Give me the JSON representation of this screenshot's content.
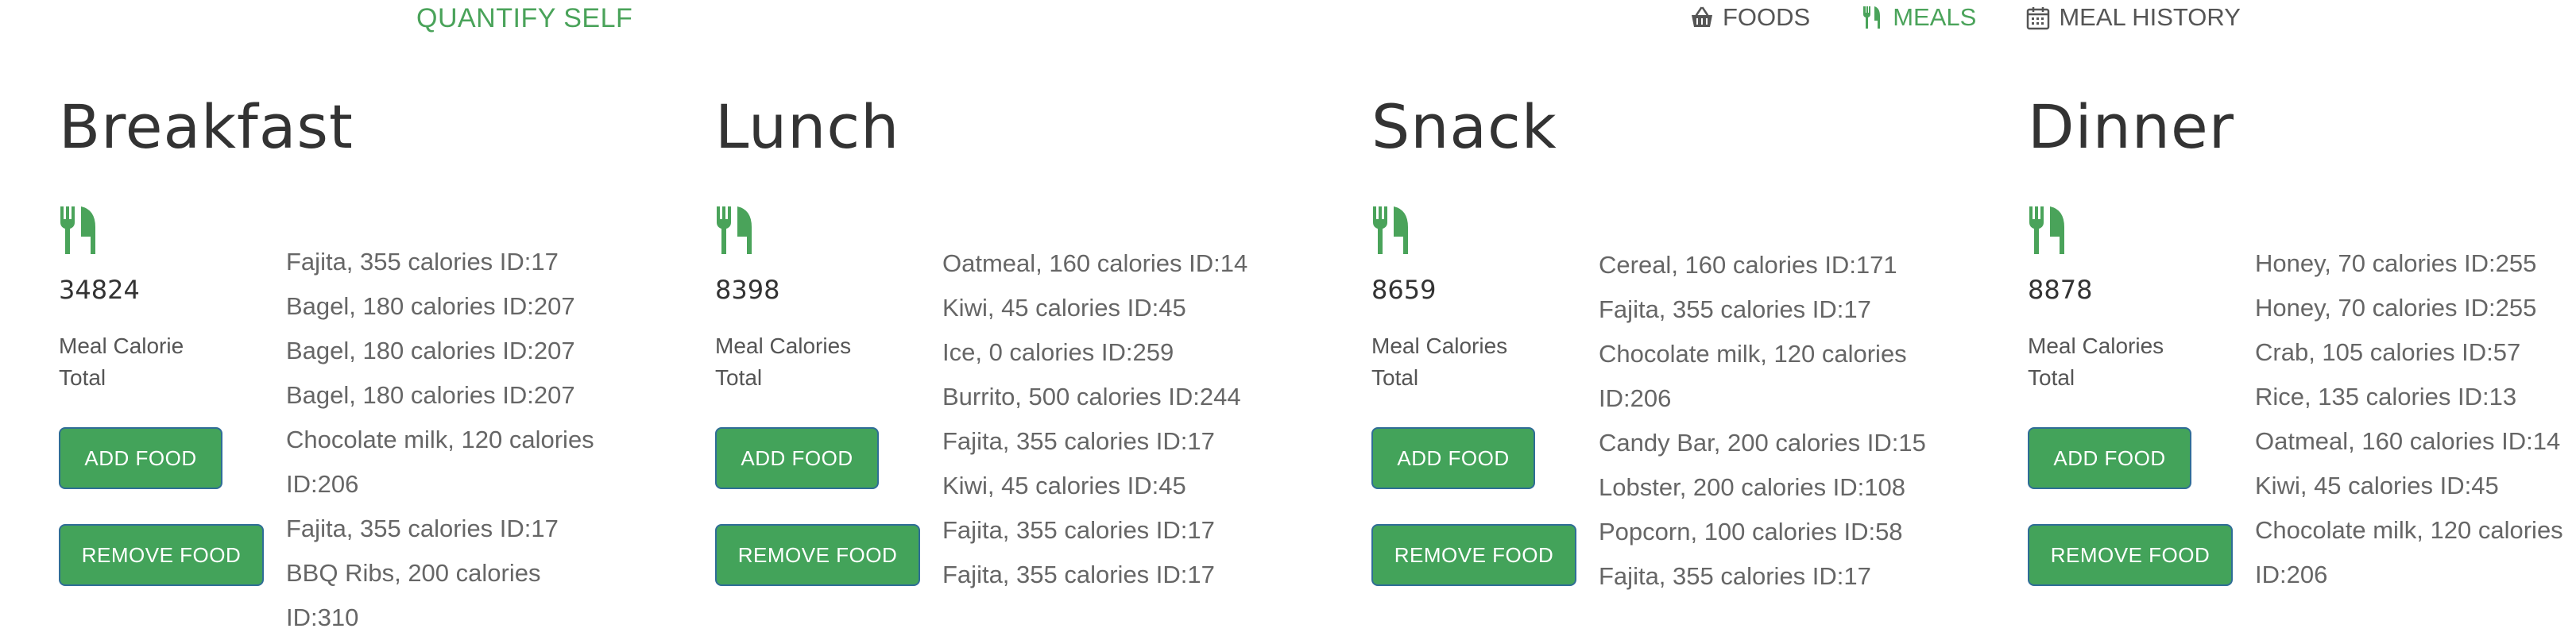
{
  "brand": "QUANTIFY SELF",
  "nav": {
    "foods": "FOODS",
    "meals": "MEALS",
    "history": "MEAL HISTORY"
  },
  "accent_color": "#4aa35a",
  "meals": [
    {
      "title": "Breakfast",
      "total": "34824",
      "total_label": "Meal Calorie Total",
      "add_label": "ADD FOOD",
      "remove_label": "REMOVE FOOD",
      "foods": [
        "Fajita, 355 calories ID:17",
        "Bagel, 180 calories ID:207",
        "Bagel, 180 calories ID:207",
        "Bagel, 180 calories ID:207",
        "Chocolate milk, 120 calories ID:206",
        "Fajita, 355 calories ID:17",
        "BBQ Ribs, 200 calories ID:310"
      ]
    },
    {
      "title": "Lunch",
      "total": "8398",
      "total_label": "Meal Calories Total",
      "add_label": "ADD FOOD",
      "remove_label": "REMOVE FOOD",
      "foods": [
        "Oatmeal, 160 calories ID:14",
        "Kiwi, 45 calories ID:45",
        "Ice, 0 calories ID:259",
        "Burrito, 500 calories ID:244",
        "Fajita, 355 calories ID:17",
        "Kiwi, 45 calories ID:45",
        "Fajita, 355 calories ID:17",
        "Fajita, 355 calories ID:17"
      ]
    },
    {
      "title": "Snack",
      "total": "8659",
      "total_label": "Meal Calories Total",
      "add_label": "ADD FOOD",
      "remove_label": "REMOVE FOOD",
      "foods": [
        "Cereal, 160 calories ID:171",
        "Fajita, 355 calories ID:17",
        "Chocolate milk, 120 calories ID:206",
        "Candy Bar, 200 calories ID:15",
        "Lobster, 200 calories ID:108",
        "Popcorn, 100 calories ID:58",
        "Fajita, 355 calories ID:17"
      ]
    },
    {
      "title": "Dinner",
      "total": "8878",
      "total_label": "Meal Calories Total",
      "add_label": "ADD FOOD",
      "remove_label": "REMOVE FOOD",
      "foods": [
        "Honey, 70 calories ID:255",
        "Honey, 70 calories ID:255",
        "Crab, 105 calories ID:57",
        "Rice, 135 calories ID:13",
        "Oatmeal, 160 calories ID:14",
        "Kiwi, 45 calories ID:45",
        "Chocolate milk, 120 calories ID:206"
      ]
    }
  ]
}
